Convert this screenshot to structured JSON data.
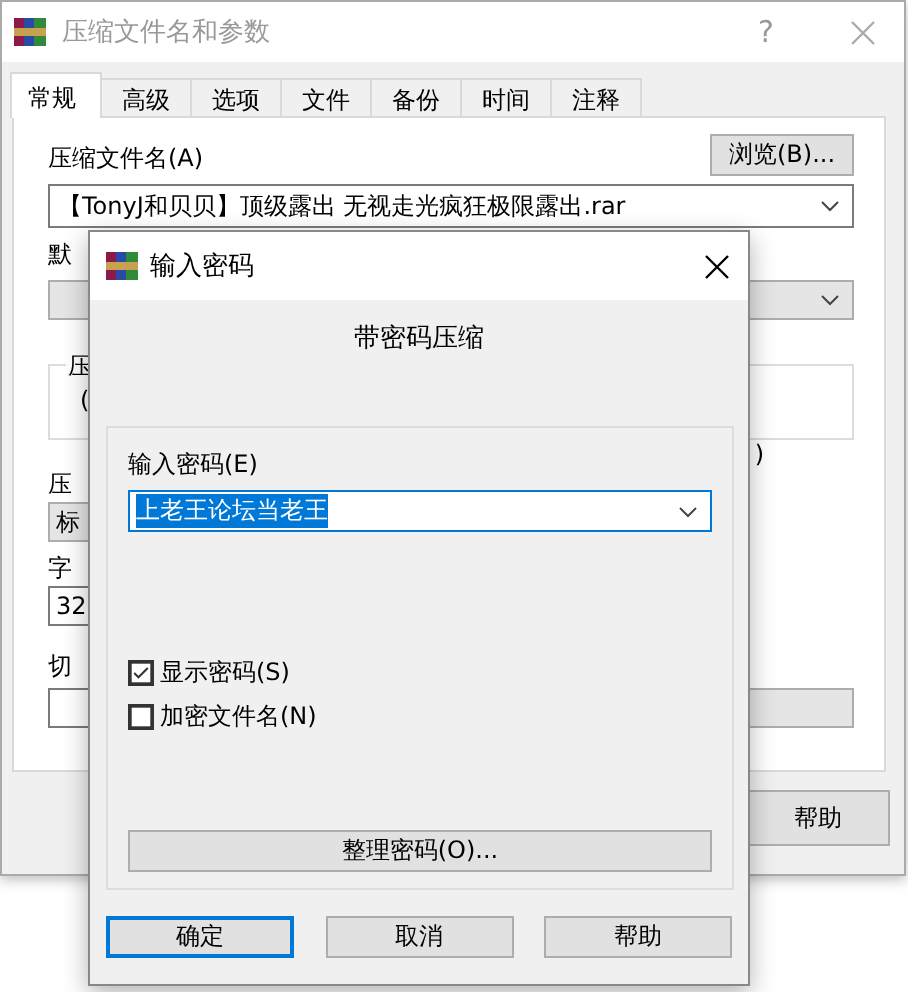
{
  "window": {
    "title": "压缩文件名和参数",
    "help_glyph": "?"
  },
  "tabs": [
    {
      "label": "常规",
      "selected": true
    },
    {
      "label": "高级",
      "selected": false
    },
    {
      "label": "选项",
      "selected": false
    },
    {
      "label": "文件",
      "selected": false
    },
    {
      "label": "备份",
      "selected": false
    },
    {
      "label": "时间",
      "selected": false
    },
    {
      "label": "注释",
      "selected": false
    }
  ],
  "general": {
    "archive_label": "压缩文件名(A)",
    "browse_button": "浏览(B)...",
    "archive_name": "【TonyJ和贝贝】顶级露出 无视走光疯狂极限露出.rar",
    "profile_label": "默",
    "group_caption": "压",
    "group_text_left": "(",
    "group_text_right": ")",
    "method_label": "压",
    "method_value": "标",
    "dictionary_label": "字",
    "dictionary_value": "32",
    "split_label": "切"
  },
  "footer_buttons": [
    "帮助"
  ],
  "password_dialog": {
    "title": "输入密码",
    "heading": "带密码压缩",
    "password_label": "输入密码(E)",
    "password_value": "上老王论坛当老王",
    "options": [
      {
        "label": "显示密码(S)",
        "checked": true
      },
      {
        "label": "加密文件名(N)",
        "checked": false
      }
    ],
    "organize_button": "整理密码(O)...",
    "buttons": [
      {
        "label": "确定",
        "default": true
      },
      {
        "label": "取消",
        "default": false
      },
      {
        "label": "帮助",
        "default": false
      }
    ]
  }
}
